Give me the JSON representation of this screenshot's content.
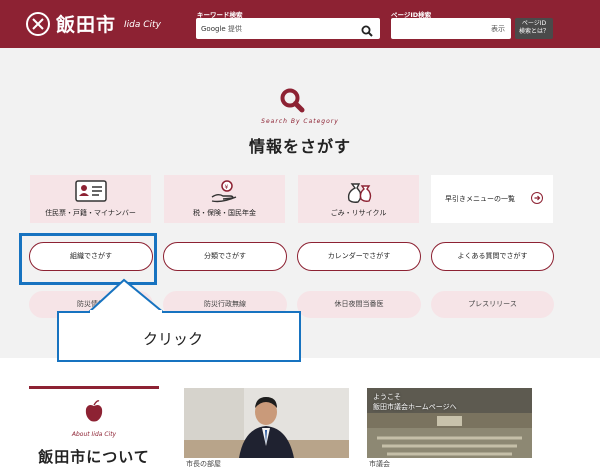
{
  "header": {
    "city_name": "飯田市",
    "city_sub": "Iida City",
    "keyword_label": "キーワード検索",
    "google_text": "Google",
    "google_suffix": "提供",
    "page_id_label": "ページID検索",
    "page_id_button": "表示",
    "page_id_help": "ページID\n検索とは？"
  },
  "search": {
    "subtitle": "Search By Category",
    "title": "情報をさがす",
    "categories": [
      {
        "label": "住民票・戸籍・マイナンバー",
        "icon": "id-card-icon"
      },
      {
        "label": "税・保険・国民年金",
        "icon": "tax-coin-hand-icon"
      },
      {
        "label": "ごみ・リサイクル",
        "icon": "garbage-bag-icon"
      }
    ],
    "quick_menu": "早引きメニューの一覧",
    "pills": [
      "組織でさがす",
      "分類でさがす",
      "カレンダーでさがす",
      "よくある質問でさがす"
    ],
    "soft_pills": [
      "防災情報",
      "防災行政無線",
      "休日夜間当番医",
      "プレスリリース"
    ]
  },
  "annotation": {
    "callout_text": "クリック",
    "color": "#1773c0"
  },
  "about": {
    "subtitle": "About Iida City",
    "title": "飯田市について",
    "photo2_overlay": "ようこそ\n飯田市議会ホームページへ",
    "caption1": "市長の部屋",
    "caption2": "市議会"
  },
  "colors": {
    "brand": "#8d2233",
    "card_pink": "#f6e4e7",
    "section_bg": "#f2f2f2"
  }
}
